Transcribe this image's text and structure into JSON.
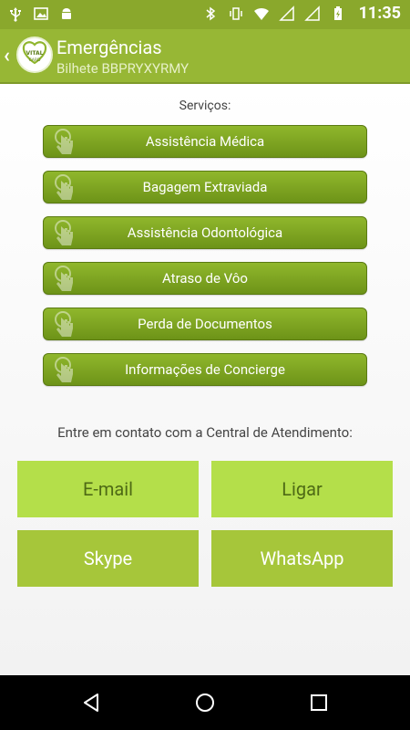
{
  "status_bar": {
    "time": "11:35",
    "sim1": "1",
    "sim2": "2"
  },
  "header": {
    "title": "Emergências",
    "subtitle": "Bilhete BBPRYXYRMY",
    "logo_text": "VITAL CARD"
  },
  "services": {
    "label": "Serviços:",
    "items": [
      {
        "label": "Assistência Médica"
      },
      {
        "label": "Bagagem Extraviada"
      },
      {
        "label": "Assistência Odontológica"
      },
      {
        "label": "Atraso de Vôo"
      },
      {
        "label": "Perda de Documentos"
      },
      {
        "label": "Informações de Concierge"
      }
    ]
  },
  "contact": {
    "label": "Entre em contato com a Central de Atendimento:",
    "email": "E-mail",
    "call": "Ligar",
    "skype": "Skype",
    "whatsapp": "WhatsApp"
  },
  "colors": {
    "accent": "#97b735",
    "button_green": "#7ea323",
    "light_green": "#b4df4a"
  },
  "icons": {
    "back": "back-triangle-icon",
    "home": "home-circle-icon",
    "recents": "recents-square-icon",
    "tap": "tap-finger-icon"
  }
}
